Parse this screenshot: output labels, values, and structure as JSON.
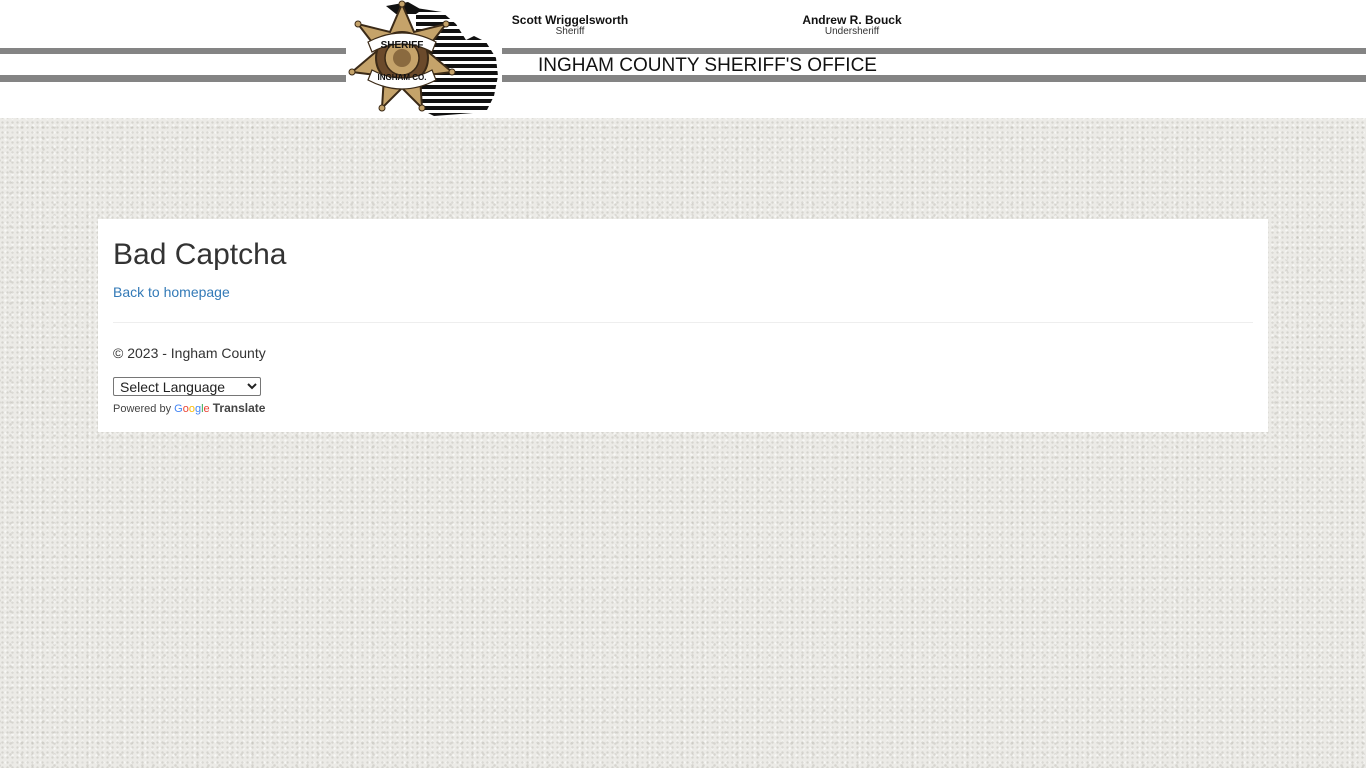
{
  "header": {
    "sheriff_name": "Scott Wriggelsworth",
    "sheriff_title": "Sheriff",
    "undersheriff_name": "Andrew R. Bouck",
    "undersheriff_title": "Undersheriff",
    "office_name": "INGHAM COUNTY SHERIFF'S OFFICE",
    "badge_top_text": "SHERIFF",
    "badge_bottom_text": "INGHAM CO."
  },
  "main": {
    "title": "Bad Captcha",
    "back_link": "Back to homepage",
    "copyright": "© 2023 - Ingham County"
  },
  "translate": {
    "selected_language": "Select Language",
    "powered_by": "Powered by",
    "google": "Google",
    "translate_label": "Translate"
  },
  "colors": {
    "link": "#337ab7",
    "stripe": "#848484",
    "badge_gold": "#c5a36a",
    "badge_brown": "#6b4a2b"
  }
}
